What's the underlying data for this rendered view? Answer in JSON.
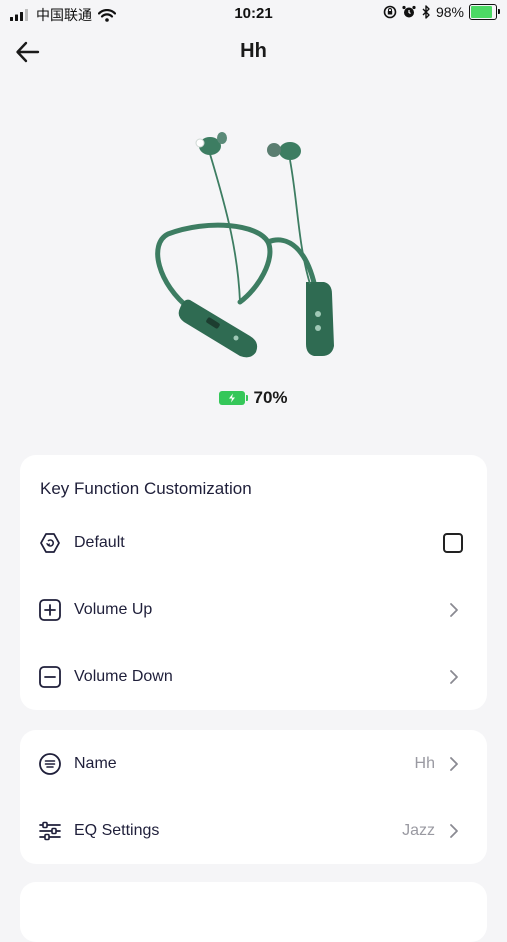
{
  "status_bar": {
    "carrier": "中国联通",
    "time": "10:21",
    "battery": "98%"
  },
  "nav": {
    "title": "Hh"
  },
  "device": {
    "battery_percent": "70%",
    "battery_level": 0.7,
    "accent_color": "#35c759"
  },
  "key_function": {
    "title": "Key Function Customization",
    "items": [
      {
        "label": "Default",
        "icon": "hexagon-cycle-icon"
      },
      {
        "label": "Volume Up",
        "icon": "plus-square-icon"
      },
      {
        "label": "Volume Down",
        "icon": "minus-square-icon"
      }
    ]
  },
  "settings": {
    "items": [
      {
        "label": "Name",
        "value": "Hh",
        "icon": "name-list-icon"
      },
      {
        "label": "EQ Settings",
        "value": "Jazz",
        "icon": "sliders-icon"
      }
    ]
  }
}
